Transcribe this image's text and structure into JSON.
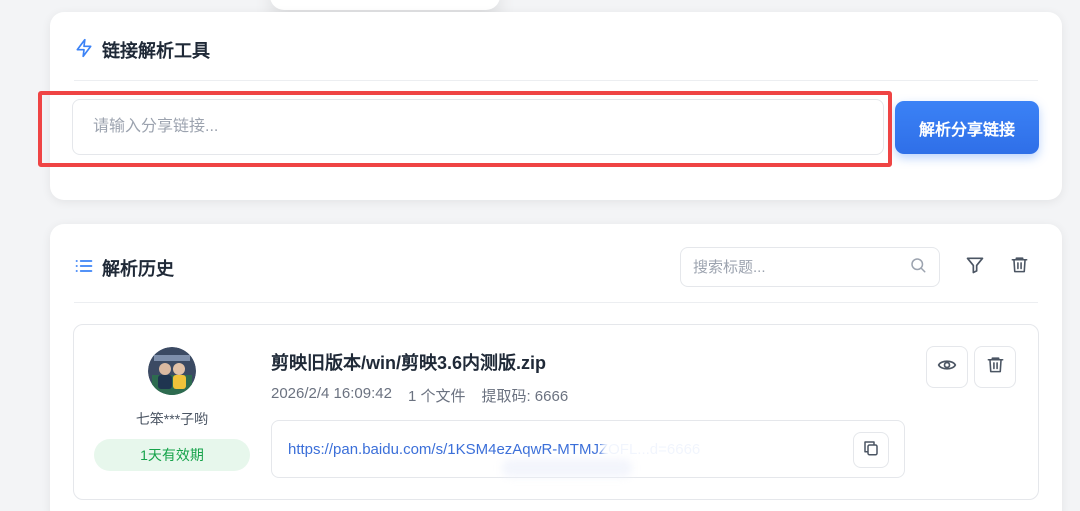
{
  "parse_tool": {
    "title": "链接解析工具",
    "title_icon": "lightning-icon",
    "input_placeholder": "请输入分享链接...",
    "parse_button_label": "解析分享链接"
  },
  "history": {
    "title": "解析历史",
    "title_icon": "list-icon",
    "search_placeholder": "搜索标题...",
    "search_icon": "search-icon",
    "filter_icon": "filter-icon",
    "clear_icon": "trash-icon",
    "records": [
      {
        "username": "七笨***子哟",
        "expiry": "1天有效期",
        "file_title": "剪映旧版本/win/剪映3.6内测版.zip",
        "date": "2026/2/4 16:09:42",
        "file_count": "1 个文件",
        "extract_code": "提取码: 6666",
        "link": "https://pan.baidu.com/s/1KSM4ezAqwR-MTMJZOFL...d=6666",
        "view_icon": "eye-icon",
        "delete_icon": "trash-icon",
        "copy_icon": "copy-icon"
      }
    ]
  },
  "colors": {
    "accent": "#3b82f6",
    "highlight": "#ef4444",
    "badge_bg": "#e7f7ec",
    "badge_text": "#16a34a",
    "link": "#3b6fd9"
  }
}
